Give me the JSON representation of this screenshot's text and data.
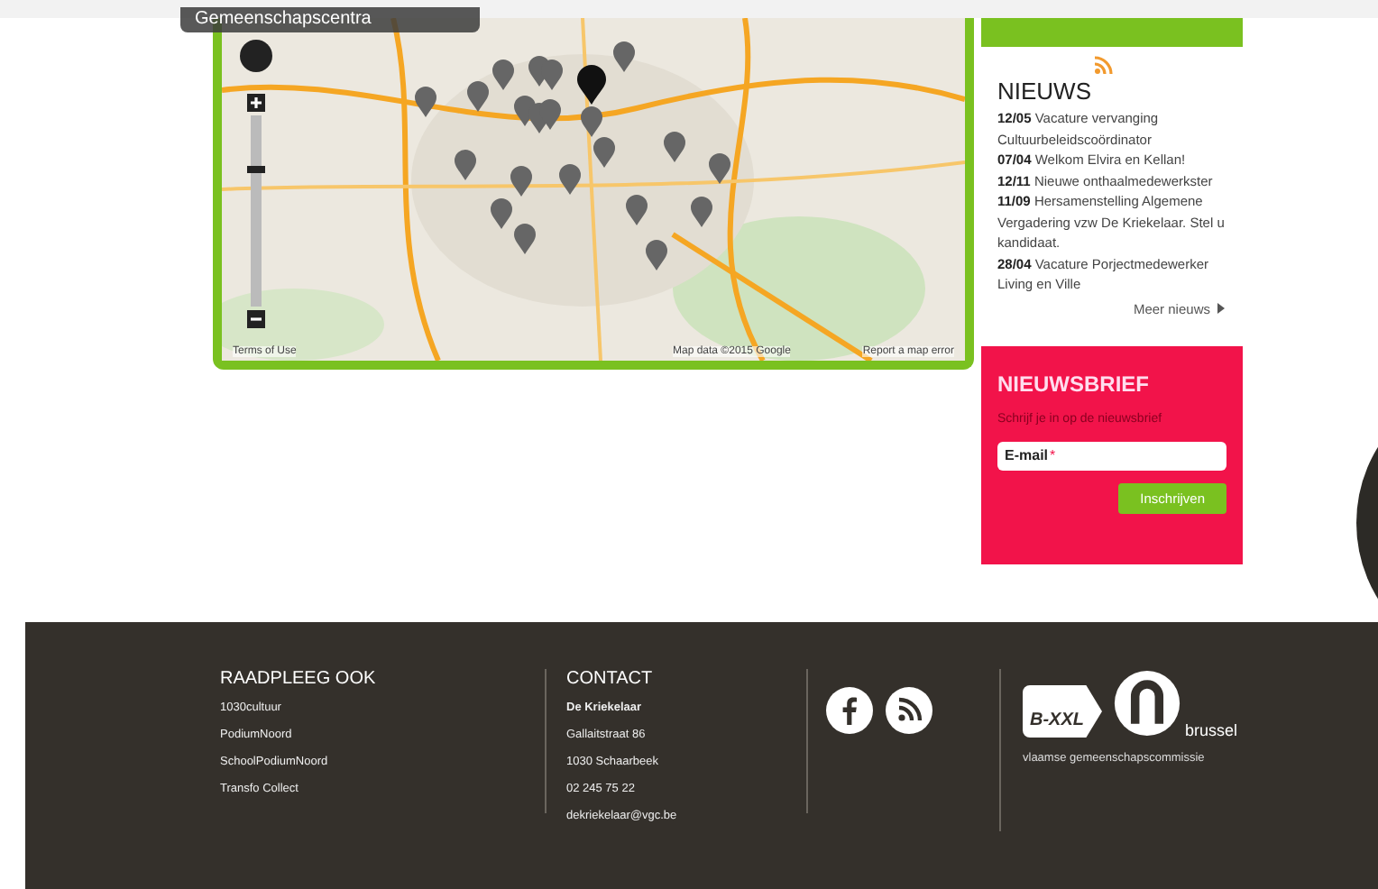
{
  "map": {
    "layer_label": "Gemeenschapscentra",
    "zoom": {
      "level": 0.73
    },
    "terms_link": "Terms of Use",
    "attribution": "Map data ©2015 Google",
    "report_link": "Report a map error"
  },
  "news": {
    "title": "NIEUWS",
    "items": [
      {
        "date": "12/05",
        "text": "Vacature vervanging Cultuurbeleidscoördinator"
      },
      {
        "date": "07/04",
        "text": "Welkom Elvira en Kellan!"
      },
      {
        "date": "12/11",
        "text": "Nieuwe onthaalmedewerkster"
      },
      {
        "date": "11/09",
        "text": "Hersamenstelling Algemene Vergadering vzw De Kriekelaar. Stel u kandidaat."
      },
      {
        "date": "28/04",
        "text": "Vacature Porjectmedewerker Living en Ville"
      }
    ],
    "more_link": "Meer nieuws"
  },
  "newsletter": {
    "title": "NIEUWSBRIEF",
    "subtitle": "Schrijf je in op de nieuwsbrief",
    "field_label": "E-mail",
    "required_mark": "*",
    "button": "Inschrijven"
  },
  "footer": {
    "links_title": "RAADPLEEG OOK",
    "links": [
      "1030cultuur",
      "PodiumNoord",
      "SchoolPodiumNoord",
      "Transfo Collect"
    ],
    "contact_title": "CONTACT",
    "contact_name": "De Kriekelaar",
    "contact_lines": [
      "Gallaitstraat 86",
      "1030 Schaarbeek",
      "02 245 75 22",
      "dekriekelaar@vgc.be"
    ],
    "logo_badge": "B-XXL",
    "logo_word": "brussel",
    "logo_caption": "vlaamse gemeenschapscommissie"
  }
}
